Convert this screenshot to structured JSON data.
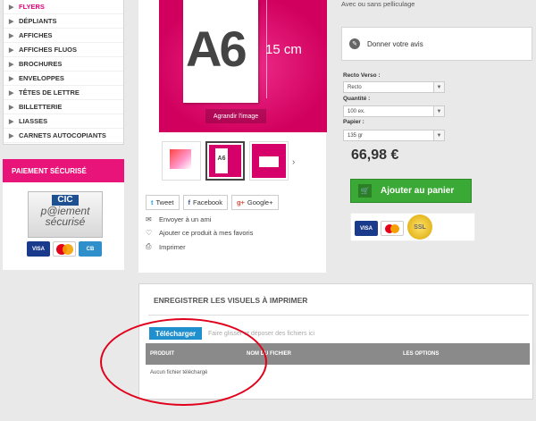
{
  "sidebar": {
    "categories": [
      {
        "label": "FLYERS",
        "active": true
      },
      {
        "label": "DÉPLIANTS",
        "active": false
      },
      {
        "label": "AFFICHES",
        "active": false
      },
      {
        "label": "AFFICHES FLUOS",
        "active": false
      },
      {
        "label": "BROCHURES",
        "active": false
      },
      {
        "label": "ENVELOPPES",
        "active": false
      },
      {
        "label": "TÊTES DE LETTRE",
        "active": false
      },
      {
        "label": "BILLETTERIE",
        "active": false
      },
      {
        "label": "LIASSES",
        "active": false
      },
      {
        "label": "CARNETS AUTOCOPIANTS",
        "active": false
      }
    ],
    "payment": {
      "title": "PAIEMENT SÉCURISÉ",
      "cic_brand": "CIC",
      "cic_line1": "p@iement",
      "cic_line2": "sécurisé",
      "card_visa": "VISA",
      "card_cb": "CB"
    }
  },
  "product": {
    "image": {
      "big_text": "A6",
      "size_label": "15 cm",
      "zoom_label": "Agrandir l'image"
    },
    "thumb_label": "A6",
    "share": {
      "tweet": "Tweet",
      "facebook": "Facebook",
      "google": "Google+"
    },
    "links": {
      "email": "Envoyer à un ami",
      "favorites": "Ajouter ce produit à mes favoris",
      "print": "Imprimer"
    }
  },
  "options": {
    "film_note": "Avec ou sans pelliculage",
    "review_label": "Donner votre avis",
    "recto_verso": {
      "label": "Recto Verso :",
      "value": "Recto"
    },
    "quantite": {
      "label": "Quantité :",
      "value": "100 ex."
    },
    "papier": {
      "label": "Papier :",
      "value": "135 gr"
    },
    "price": "66,98 €",
    "cart_label": "Ajouter au panier",
    "logo_visa": "VISA",
    "seal_label": "SSL"
  },
  "upload": {
    "title": "ENREGISTRER LES VISUELS À IMPRIMER",
    "button": "Télécharger",
    "drop_text": "Faire glisser et déposer des fichiers ici",
    "columns": [
      "PRODUIT",
      "NOM DU FICHIER",
      "LES OPTIONS"
    ],
    "empty": "Aucun fichier téléchargé"
  },
  "colors": {
    "accent": "#e8147a",
    "cart_green": "#3aa935",
    "upload_blue": "#1f8fce",
    "annotation": "#e1001c"
  }
}
